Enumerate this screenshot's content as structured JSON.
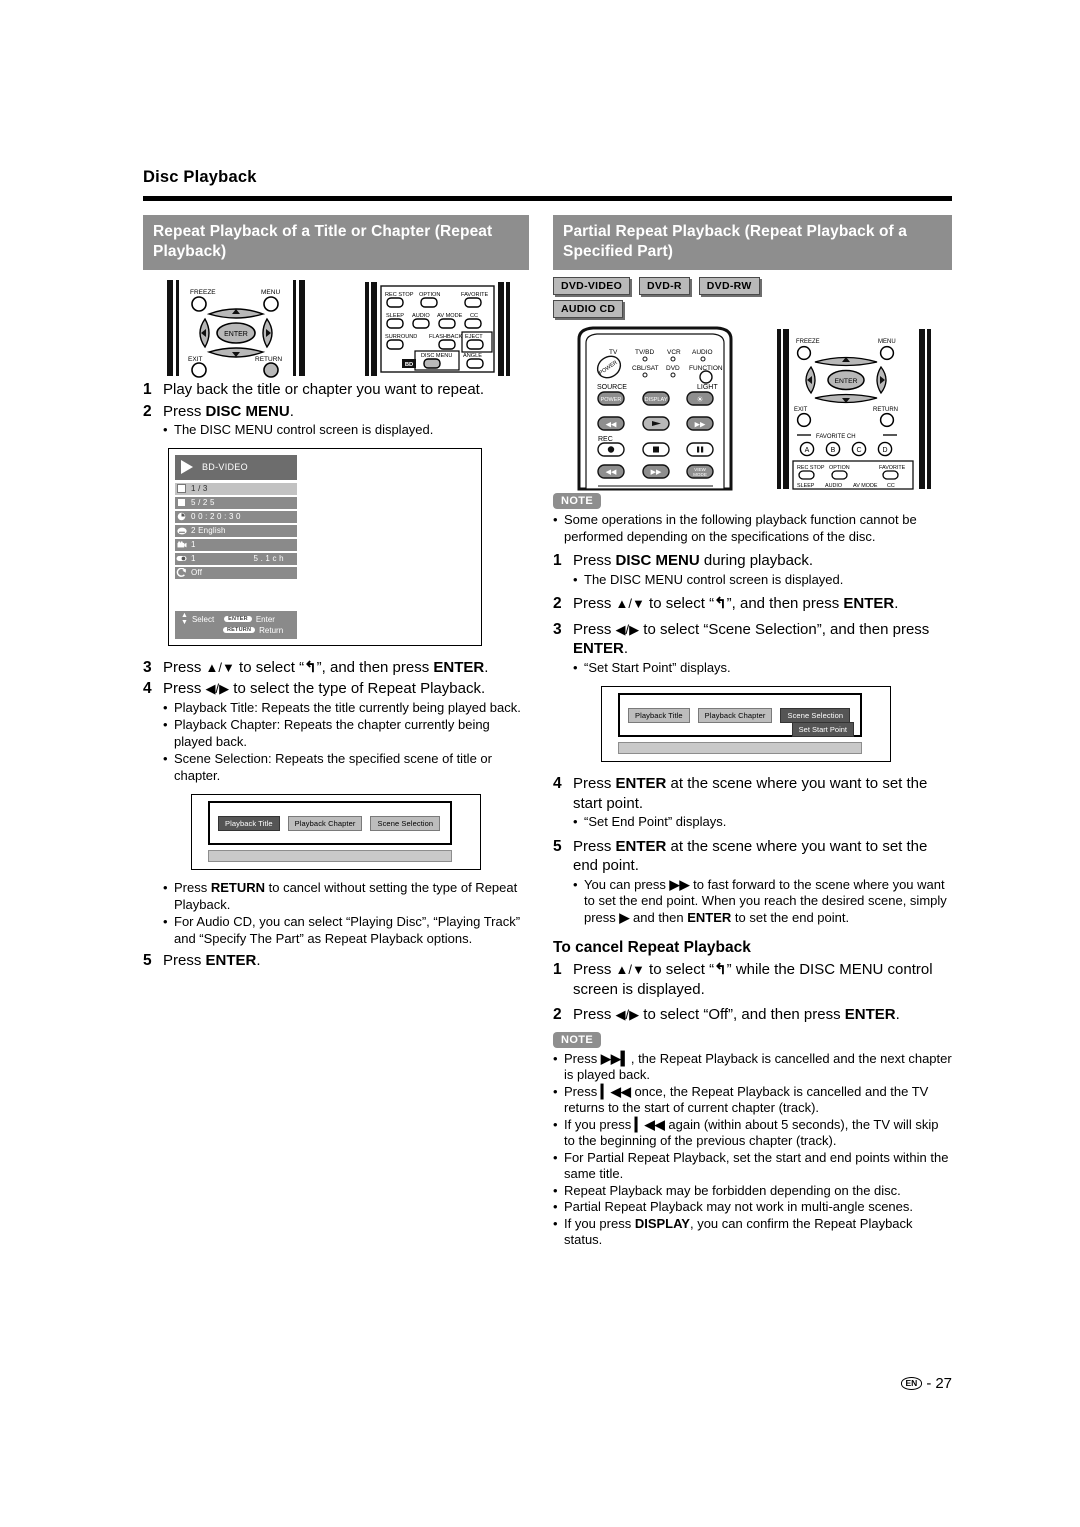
{
  "page": {
    "breadcrumb": "Disc Playback",
    "footer_locale": "EN",
    "footer_sep": "-",
    "footer_page": "27"
  },
  "left": {
    "section_title": "Repeat Playback of a Title or Chapter (Repeat Playback)",
    "steps": [
      {
        "num": "1",
        "text": "Play back the title or chapter you want to repeat."
      },
      {
        "num": "2",
        "text": "Press DISC MENU.",
        "bullets": [
          "The DISC MENU control screen is displayed."
        ]
      },
      {
        "num": "3",
        "text": "Press ▲/▼ to select “⟲”, and then press ENTER."
      },
      {
        "num": "4",
        "text": "Press ◀/▶ to select the type of Repeat Playback.",
        "bullets": [
          "Playback Title: Repeats the title currently being played back.",
          "Playback Chapter: Repeats the chapter currently being played back.",
          "Scene Selection: Repeats the specified scene of title or chapter."
        ]
      },
      {
        "num": "5",
        "text": "Press ENTER."
      }
    ],
    "after_diagram_bullets": [
      "Press RETURN to cancel without setting the type of Repeat Playback.",
      "For Audio CD, you can select “Playing Disc”, “Playing Track” and “Specify The Part” as Repeat Playback options."
    ],
    "disc_menu_screen": {
      "title": "BD-VIDEO",
      "rows": [
        {
          "icon": "square-icon",
          "label": "1 / 3",
          "value": "",
          "selected": true
        },
        {
          "icon": "square-icon",
          "label": "5 / 2 5",
          "value": "",
          "selected": false
        },
        {
          "icon": "clock-icon",
          "label": "0 0 : 2 0 : 3 0",
          "value": "",
          "selected": false
        },
        {
          "icon": "subtitle-icon",
          "label": "2 English",
          "value": "",
          "selected": false
        },
        {
          "icon": "angle-icon",
          "label": "1",
          "value": "",
          "selected": false
        },
        {
          "icon": "audio-icon",
          "label": "1",
          "value": "5 . 1 c h",
          "selected": false
        },
        {
          "icon": "repeat-icon",
          "label": "Off",
          "value": "",
          "selected": false
        }
      ],
      "legend": {
        "select_label": "Select",
        "enter_key": "ENTER",
        "enter_label": "Enter",
        "return_key": "RETURN",
        "return_label": "Return"
      }
    },
    "type_selector": {
      "buttons": [
        {
          "label": "Playback Title",
          "highlighted": true
        },
        {
          "label": "Playback Chapter",
          "highlighted": false
        },
        {
          "label": "Scene Selection",
          "highlighted": false
        }
      ]
    },
    "remote_top": {
      "labels": [
        "FREEZE",
        "MENU",
        "ENTER",
        "EXIT",
        "RETURN"
      ],
      "keypad_labels": [
        "REC STOP",
        "OPTION",
        "FAVORITE",
        "SLEEP",
        "AUDIO",
        "AV MODE",
        "CC",
        "SURROUND",
        "FLASHBACK",
        "EJECT",
        "DISC MENU",
        "ANGLE",
        "BD"
      ]
    }
  },
  "right": {
    "section_title": "Partial Repeat Playback (Repeat Playback of a Specified Part)",
    "badges_row1": [
      "DVD-VIDEO",
      "DVD-R",
      "DVD-RW"
    ],
    "badges_row2": [
      "AUDIO CD"
    ],
    "note_label": "NOTE",
    "note_top_bullets": [
      "Some operations in the following playback function cannot be performed depending on the specifications of the disc."
    ],
    "steps": [
      {
        "num": "1",
        "text": "Press DISC MENU during playback.",
        "bullets": [
          "The DISC MENU control screen is displayed."
        ]
      },
      {
        "num": "2",
        "text": "Press ▲/▼ to select “⟲”, and then press ENTER."
      },
      {
        "num": "3",
        "text": "Press ◀/▶ to select “Scene Selection”, and then press ENTER.",
        "bullets": [
          "“Set Start Point” displays."
        ]
      },
      {
        "num": "4",
        "text": "Press ENTER at the scene where you want to set the start point.",
        "bullets": [
          "“Set End Point” displays."
        ]
      },
      {
        "num": "5",
        "text": "Press ENTER at the scene where you want to set the end point.",
        "bullets": [
          "You can press ▶▶ to fast forward to the scene where you want to set the end point. When you reach the desired scene, simply press ▶ and then ENTER to set the end point."
        ]
      }
    ],
    "cancel_heading": "To cancel Repeat Playback",
    "cancel_steps": [
      {
        "num": "1",
        "text": "Press ▲/▼ to select “⟲” while the DISC MENU control screen is displayed."
      },
      {
        "num": "2",
        "text": "Press ◀/▶ to select “Off”, and then press ENTER."
      }
    ],
    "note_label_2": "NOTE",
    "note_bottom_bullets": [
      "Press ▶▶▌, the Repeat Playback is cancelled and the next chapter is played back.",
      "Press ▌◀◀ once, the Repeat Playback is cancelled and the TV returns to the start of current chapter (track).",
      "If you press ▌◀◀ again (within about 5 seconds), the TV will skip to the beginning of the previous chapter (track).",
      "For Partial Repeat Playback, set the start and end points within the same title.",
      "Repeat Playback may be forbidden depending on the disc.",
      "Partial Repeat Playback may not work in multi-angle scenes.",
      "If you press DISPLAY, you can confirm the Repeat Playback status."
    ],
    "scene_selector": {
      "buttons": [
        {
          "label": "Playback Title",
          "highlighted": false
        },
        {
          "label": "Playback Chapter",
          "highlighted": false
        },
        {
          "label": "Scene Selection",
          "highlighted": true
        }
      ],
      "second_row": {
        "label": "Set Start Point",
        "highlighted": true
      }
    },
    "remote_main": {
      "brand_labels": [
        "TV",
        "TV/BD",
        "VCR",
        "AUDIO",
        "CBL/SAT",
        "DVD",
        "FUNCTION",
        "SOURCE",
        "POWER",
        "DISPLAY",
        "LIGHT",
        "REC",
        "VIEW MODE"
      ]
    },
    "remote_side": {
      "labels": [
        "FREEZE",
        "MENU",
        "ENTER",
        "EXIT",
        "RETURN",
        "FAVORITE CH",
        "A",
        "B",
        "C",
        "D",
        "REC STOP",
        "OPTION",
        "FAVORITE",
        "SLEEP",
        "AUDIO",
        "AV MODE",
        "CC"
      ]
    }
  },
  "colors": {
    "section_bar": "#8e8e8e",
    "badge_fill": "#b9b9b9",
    "screen_row": "#8a8a8a",
    "screen_row_selected": "#c2c2c2",
    "highlight_dark": "#555555"
  }
}
